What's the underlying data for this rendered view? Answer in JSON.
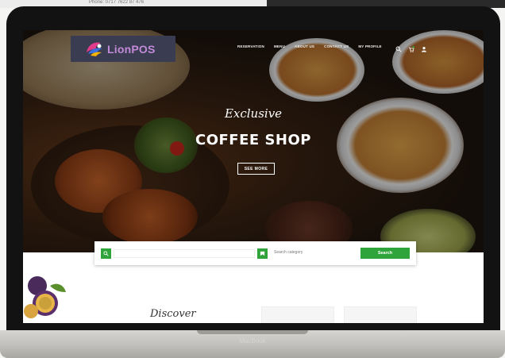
{
  "top_strip": {
    "phone": "Phone: 0717 7622 87 476"
  },
  "logo": {
    "text": "LionPOS"
  },
  "nav": {
    "items": [
      "RESERVATION",
      "MENU",
      "ABOUT US",
      "CONTACT US",
      "MY PROFILE"
    ],
    "icons": [
      "search-icon",
      "cart-icon",
      "user-icon"
    ]
  },
  "hero": {
    "script_title": "Exclusive",
    "headline": "COFFEE SHOP",
    "button_label": "SEE MORE"
  },
  "search": {
    "placeholder": "",
    "category_placeholder": "Search category",
    "button_label": "Search"
  },
  "lower": {
    "section_title": "Discover"
  },
  "device": {
    "brand": "MacBook"
  },
  "colors": {
    "accent_green": "#2fa43a",
    "logo_bg": "#3a3c52",
    "logo_text": "#c28ad6"
  }
}
